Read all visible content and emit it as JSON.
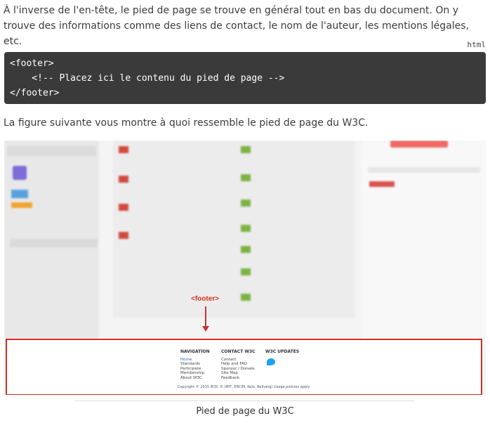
{
  "intro_paragraph": "À l'inverse de l'en-tête, le pied de page se trouve en général tout en bas du document. On y trouve des informations comme des liens de contact, le nom de l'auteur, les mentions légales, etc.",
  "code_block": {
    "language": "html",
    "lines": [
      "<footer>",
      "    <!-- Placez ici le contenu du pied de page -->",
      "</footer>"
    ]
  },
  "second_paragraph": "La figure suivante vous montre à quoi ressemble le pied de page du W3C.",
  "figure": {
    "annotation_label": "<footer>",
    "footer": {
      "navigation": {
        "heading": "NAVIGATION",
        "links": [
          "Home",
          "Standards",
          "Participate",
          "Membership",
          "About W3C"
        ]
      },
      "contact": {
        "heading": "CONTACT W3C",
        "links": [
          "Contact",
          "Help and FAQ",
          "Sponsor / Donate",
          "Site Map",
          "Feedback"
        ]
      },
      "updates": {
        "heading": "W3C UPDATES"
      },
      "copyright": "Copyright © 2015 W3C ® (MIT, ERCIM, Keio, Beihang) Usage policies apply."
    },
    "caption": "Pied de page du W3C"
  },
  "colors": {
    "annotation_red": "#d33022",
    "code_bg": "#3a3a3a",
    "twitter_blue": "#1da1f2"
  }
}
